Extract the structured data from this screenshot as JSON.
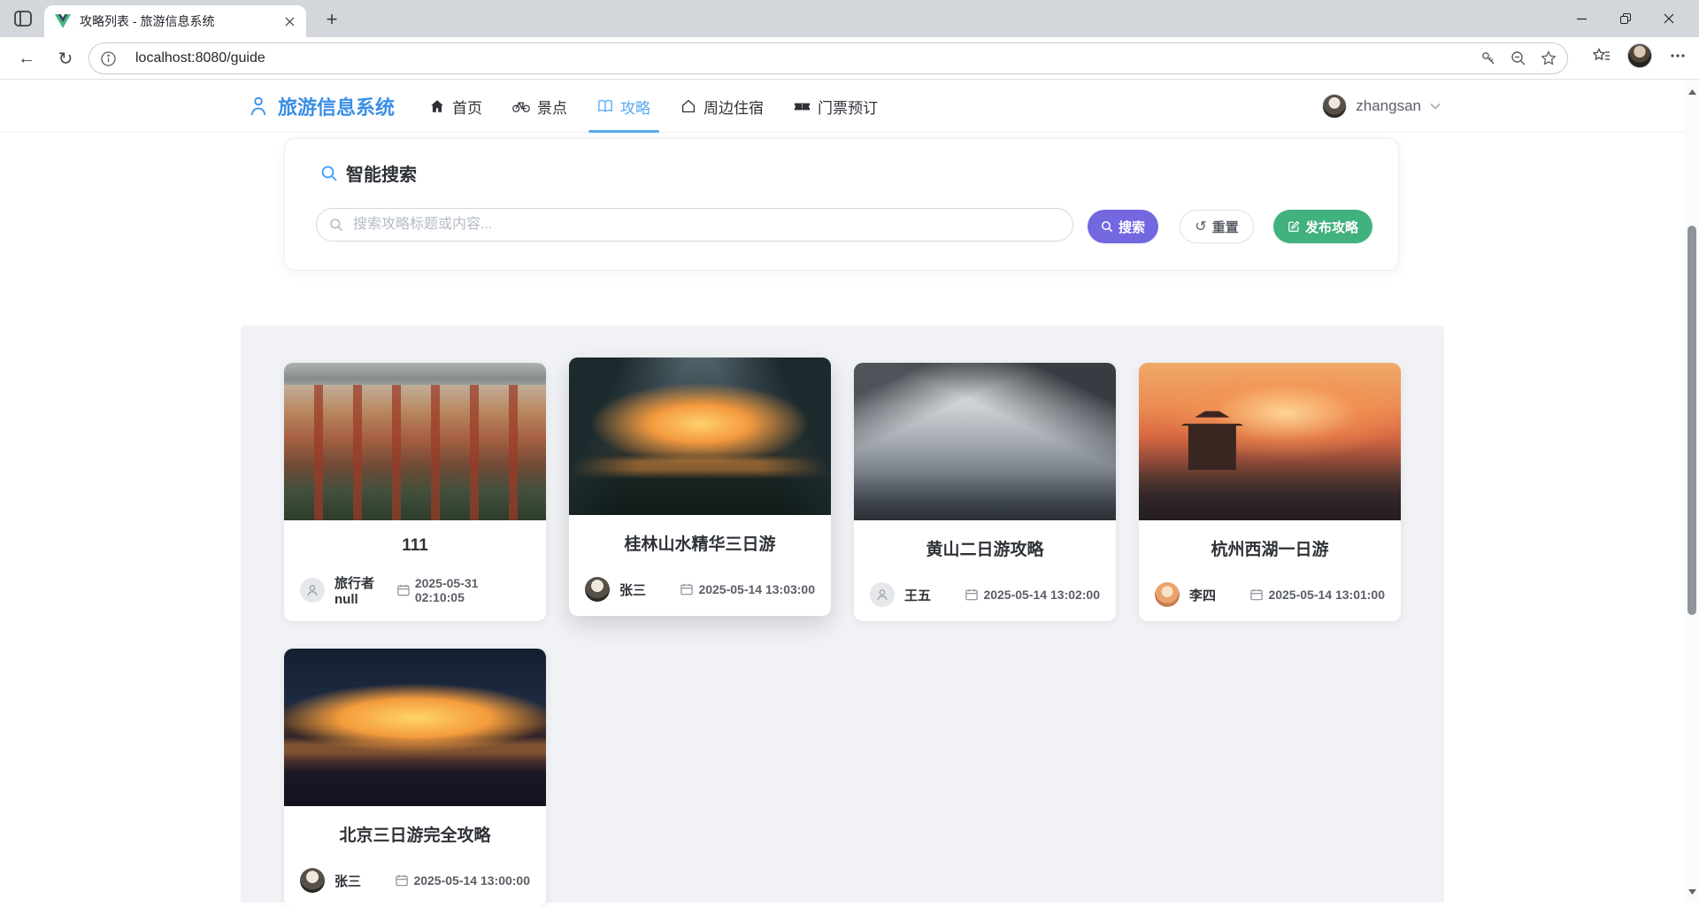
{
  "browser": {
    "tab_title": "攻略列表 - 旅游信息系统",
    "url": "localhost:8080/guide",
    "icons": {
      "tab_favicon": "vue-logo",
      "toolbar": [
        "back-arrow",
        "refresh",
        "site-info",
        "password-key",
        "zoom-out",
        "bookmark-star",
        "favorites-list-star",
        "profile-avatar",
        "more-dots"
      ],
      "window": [
        "minimize",
        "restore",
        "close"
      ]
    }
  },
  "header": {
    "brand": "旅游信息系统",
    "brand_icon": "traveler-person",
    "nav": [
      {
        "label": "首页",
        "icon": "home-icon",
        "active": false
      },
      {
        "label": "景点",
        "icon": "scenic-bicycle-icon",
        "active": false
      },
      {
        "label": "攻略",
        "icon": "guide-book-icon",
        "active": true
      },
      {
        "label": "周边住宿",
        "icon": "stay-house-icon",
        "active": false
      },
      {
        "label": "门票预订",
        "icon": "ticket-icon",
        "active": false
      }
    ],
    "user": {
      "name": "zhangsan"
    }
  },
  "search": {
    "title": "智能搜索",
    "title_icon": "magnifier",
    "placeholder": "搜索攻略标题或内容...",
    "search_label": "搜索",
    "reset_label": "重置",
    "publish_label": "发布攻略"
  },
  "guides": [
    {
      "title": "111",
      "author": "旅行者null",
      "date": "2025-05-31 02:10:05",
      "avatar": "default",
      "image": "courtyard"
    },
    {
      "title": "桂林山水精华三日游",
      "author": "张三",
      "date": "2025-05-14 13:03:00",
      "avatar": "zhangsan",
      "image": "guilin"
    },
    {
      "title": "黄山二日游攻略",
      "author": "王五",
      "date": "2025-05-14 13:02:00",
      "avatar": "default",
      "image": "huangshan"
    },
    {
      "title": "杭州西湖一日游",
      "author": "李四",
      "date": "2025-05-14 13:01:00",
      "avatar": "lisi",
      "image": "westlake"
    },
    {
      "title": "北京三日游完全攻略",
      "author": "张三",
      "date": "2025-05-14 13:00:00",
      "avatar": "zhangsan",
      "image": "birdnest"
    }
  ],
  "colors": {
    "brand_blue": "#3a8ee6",
    "active_nav_blue": "#58a9f0",
    "search_button_purple": "#7468e1",
    "publish_button_green": "#41b17d",
    "page_background_gray": "#f0f2f5"
  }
}
